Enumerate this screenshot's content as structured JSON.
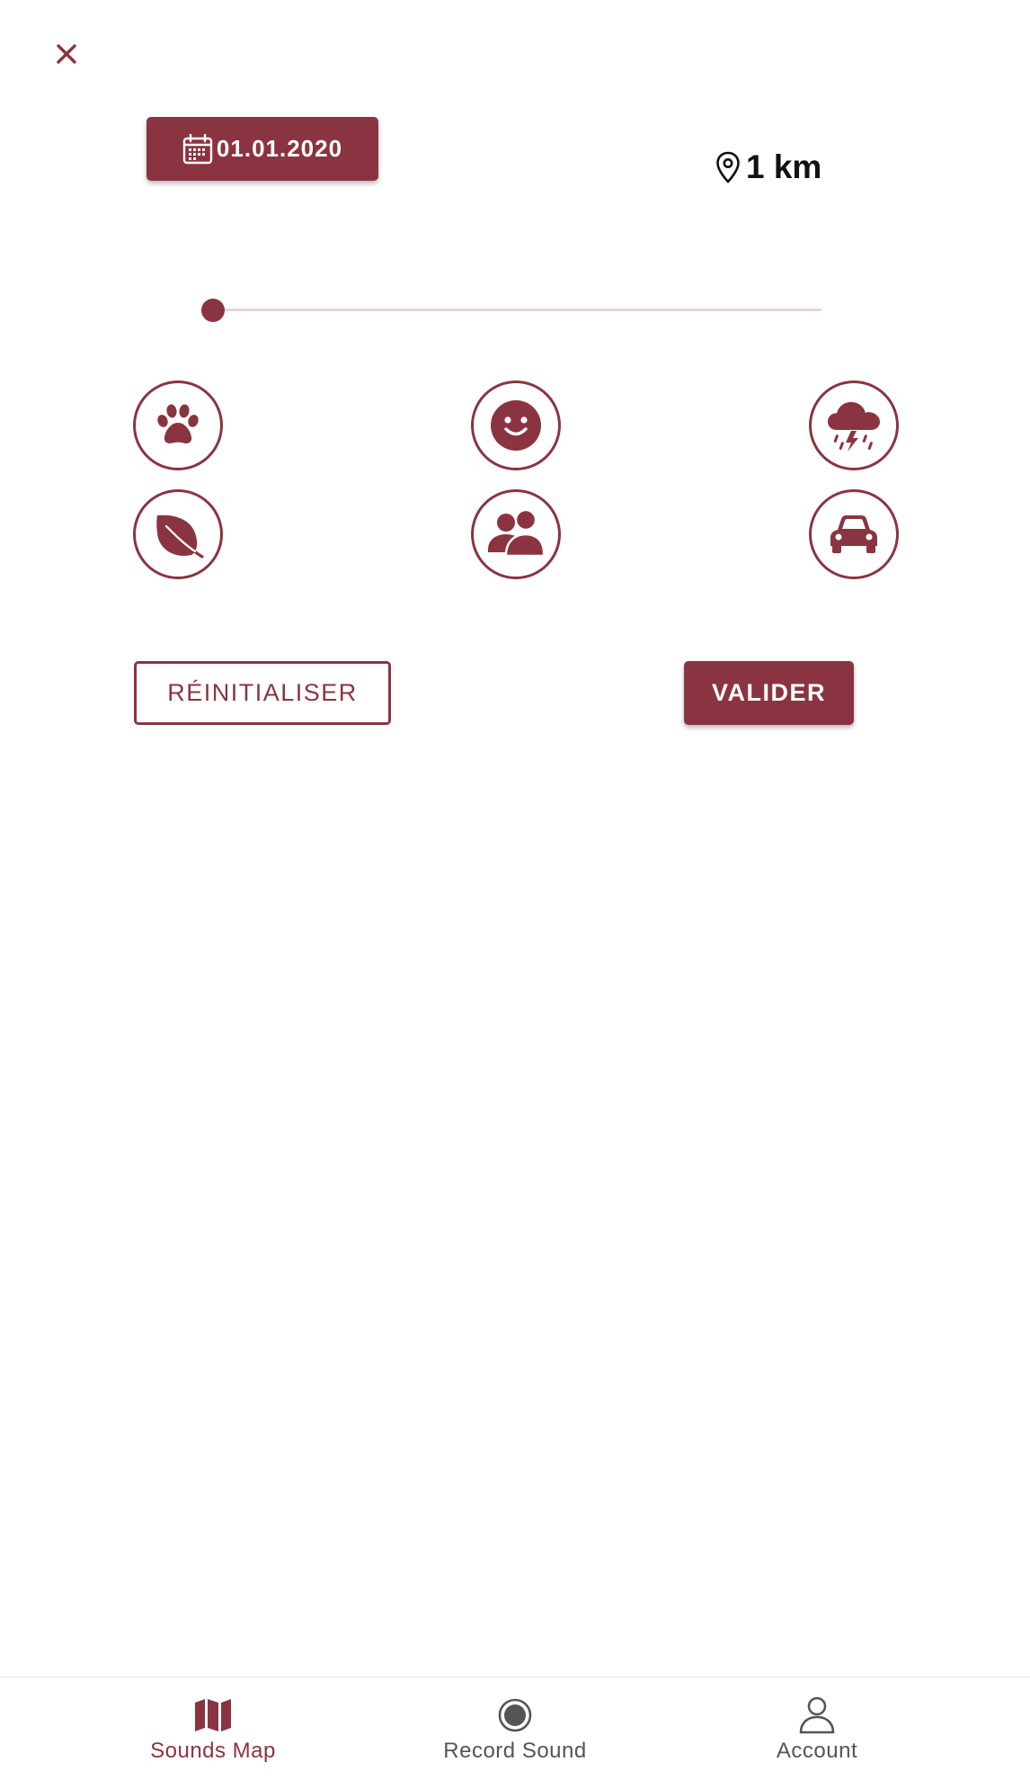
{
  "colors": {
    "accent": "#8b3441",
    "track": "#e8d4d7",
    "nav_inactive": "#555555"
  },
  "header": {
    "close_icon": "close-icon"
  },
  "filters": {
    "date": {
      "label": "01.01.2020",
      "icon": "calendar-icon"
    },
    "distance": {
      "label": "1 km",
      "icon": "map-pin-icon"
    },
    "distance_slider": {
      "value": 0
    }
  },
  "categories": [
    {
      "name": "animals",
      "icon": "paw-icon"
    },
    {
      "name": "emotions",
      "icon": "smile-icon"
    },
    {
      "name": "weather",
      "icon": "storm-cloud-icon"
    },
    {
      "name": "nature",
      "icon": "leaf-icon"
    },
    {
      "name": "people",
      "icon": "users-icon"
    },
    {
      "name": "vehicles",
      "icon": "car-icon"
    }
  ],
  "actions": {
    "reset_label": "RÉINITIALISER",
    "submit_label": "VALIDER"
  },
  "bottom_nav": {
    "items": [
      {
        "label": "Sounds Map",
        "icon": "map-icon",
        "active": true
      },
      {
        "label": "Record Sound",
        "icon": "record-icon",
        "active": false
      },
      {
        "label": "Account",
        "icon": "user-icon",
        "active": false
      }
    ]
  }
}
